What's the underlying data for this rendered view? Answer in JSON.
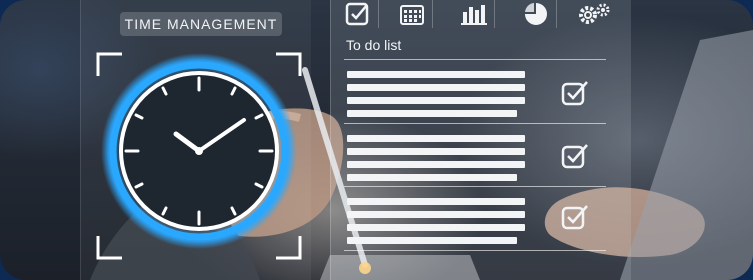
{
  "time_label": "TIME MANAGEMENT",
  "todo": {
    "title": "To do list",
    "items": [
      {
        "lines": 4,
        "checked": true
      },
      {
        "lines": 4,
        "checked": true
      },
      {
        "lines": 4,
        "checked": true
      }
    ]
  },
  "tabs": [
    {
      "icon": "checkbox-icon"
    },
    {
      "icon": "calendar-icon"
    },
    {
      "icon": "bar-chart-icon"
    },
    {
      "icon": "pie-chart-icon"
    },
    {
      "icon": "gears-icon"
    }
  ],
  "colors": {
    "frame_border": "#0d2a55",
    "clock_ring": "#2aa8ff",
    "ui_white": "#f3f4f6"
  }
}
